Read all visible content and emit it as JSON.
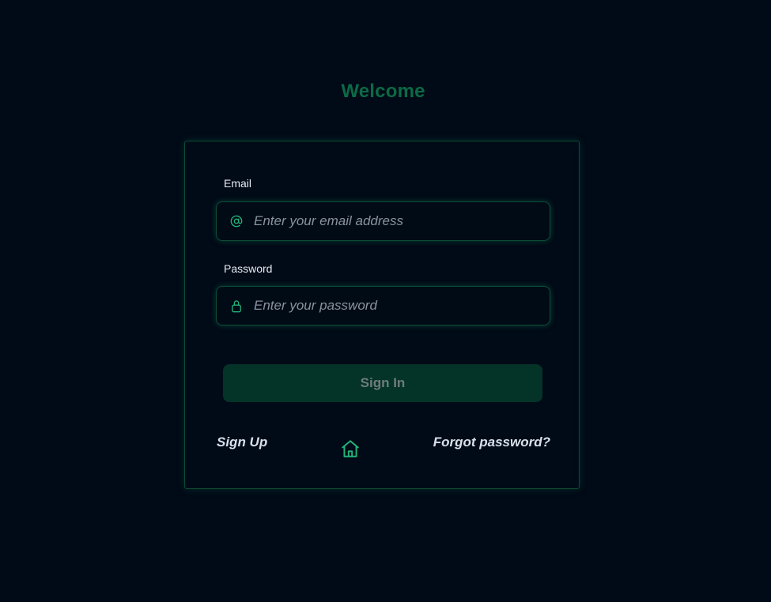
{
  "page": {
    "title": "Welcome"
  },
  "form": {
    "email": {
      "label": "Email",
      "placeholder": "Enter your email address",
      "value": ""
    },
    "password": {
      "label": "Password",
      "placeholder": "Enter your password",
      "value": ""
    },
    "submit_label": "Sign In"
  },
  "footer": {
    "signup_label": "Sign Up",
    "forgot_label": "Forgot password?"
  },
  "icons": {
    "email": "at-icon",
    "password": "lock-icon",
    "home": "home-icon"
  },
  "colors": {
    "background": "#010a17",
    "accent": "#22b37a",
    "title": "#0b6a45",
    "button_bg": "#043328"
  }
}
